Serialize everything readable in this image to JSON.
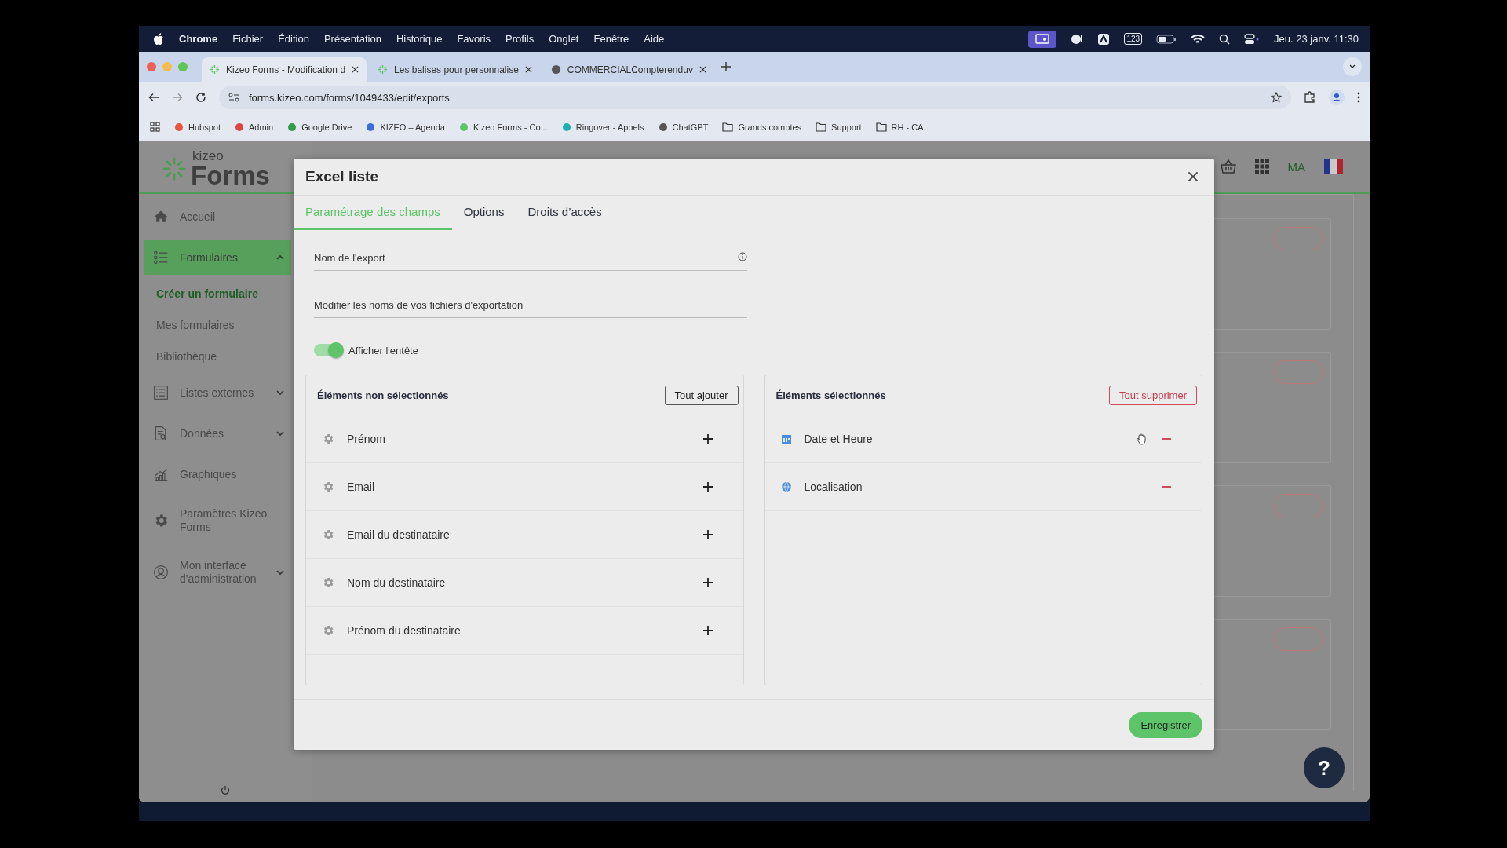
{
  "menu_bar": {
    "app": "Chrome",
    "menus": [
      "Fichier",
      "Édition",
      "Présentation",
      "Historique",
      "Favoris",
      "Profils",
      "Onglet",
      "Fenêtre",
      "Aide"
    ],
    "keyboard": "123",
    "clock": "Jeu. 23 janv.  11:30"
  },
  "browser": {
    "tabs": [
      {
        "title": "Kizeo Forms - Modification d",
        "selected": true
      },
      {
        "title": "Les balises pour personnalise",
        "selected": false
      },
      {
        "title": "COMMERCIALCompterenduv",
        "selected": false
      }
    ],
    "url": "forms.kizeo.com/forms/1049433/edit/exports",
    "bookmarks": [
      {
        "label": "Hubspot",
        "kind": "site"
      },
      {
        "label": "Admin",
        "kind": "site"
      },
      {
        "label": "Google Drive",
        "kind": "site"
      },
      {
        "label": "KIZEO – Agenda",
        "kind": "site"
      },
      {
        "label": "Kizeo Forms - Co...",
        "kind": "site"
      },
      {
        "label": "Ringover - Appels",
        "kind": "site"
      },
      {
        "label": "ChatGPT",
        "kind": "site"
      },
      {
        "label": "Grands comptes",
        "kind": "folder"
      },
      {
        "label": "Support",
        "kind": "folder"
      },
      {
        "label": "RH - CA",
        "kind": "folder"
      }
    ]
  },
  "app": {
    "logo": {
      "top": "kizeo",
      "bottom": "Forms"
    },
    "user_initials": "MA",
    "sidebar": [
      {
        "label": "Accueil",
        "kind": "link",
        "selected": false
      },
      {
        "label": "Formulaires",
        "kind": "group",
        "selected": true,
        "expanded": true,
        "children": [
          {
            "label": "Créer un formulaire",
            "selected": true
          },
          {
            "label": "Mes formulaires",
            "selected": false
          },
          {
            "label": "Bibliothèque",
            "selected": false
          }
        ]
      },
      {
        "label": "Listes externes",
        "kind": "group",
        "selected": false,
        "expanded": false
      },
      {
        "label": "Données",
        "kind": "group",
        "selected": false,
        "expanded": false
      },
      {
        "label": "Graphiques",
        "kind": "link",
        "selected": false
      },
      {
        "label": "Paramètres Kizeo Forms",
        "kind": "link",
        "selected": false
      },
      {
        "label": "Mon interface d'administration",
        "kind": "group",
        "selected": false,
        "expanded": false
      }
    ],
    "help": "?"
  },
  "modal": {
    "title": "Excel liste",
    "tabs": [
      {
        "label": "Paramétrage des champs",
        "selected": true
      },
      {
        "label": "Options",
        "selected": false
      },
      {
        "label": "Droits d’accès",
        "selected": false
      }
    ],
    "fields": [
      {
        "placeholder": "Nom de l'export",
        "info": true
      },
      {
        "placeholder": "Modifier les noms de vos fichiers d'exportation",
        "info": false
      }
    ],
    "toggle": {
      "label": "Afficher l'entête",
      "on": true
    },
    "unselected": {
      "title": "Éléments non sélectionnés",
      "button": "Tout ajouter",
      "items": [
        {
          "label": "Prénom"
        },
        {
          "label": "Email"
        },
        {
          "label": "Email du destinataire"
        },
        {
          "label": "Nom du destinataire"
        },
        {
          "label": "Prénom du destinataire"
        }
      ]
    },
    "selected": {
      "title": "Éléments sélectionnés",
      "button": "Tout supprimer",
      "items": [
        {
          "label": "Date et Heure",
          "kind": "date"
        },
        {
          "label": "Localisation",
          "kind": "location"
        }
      ]
    },
    "save": "Enregistrer"
  }
}
